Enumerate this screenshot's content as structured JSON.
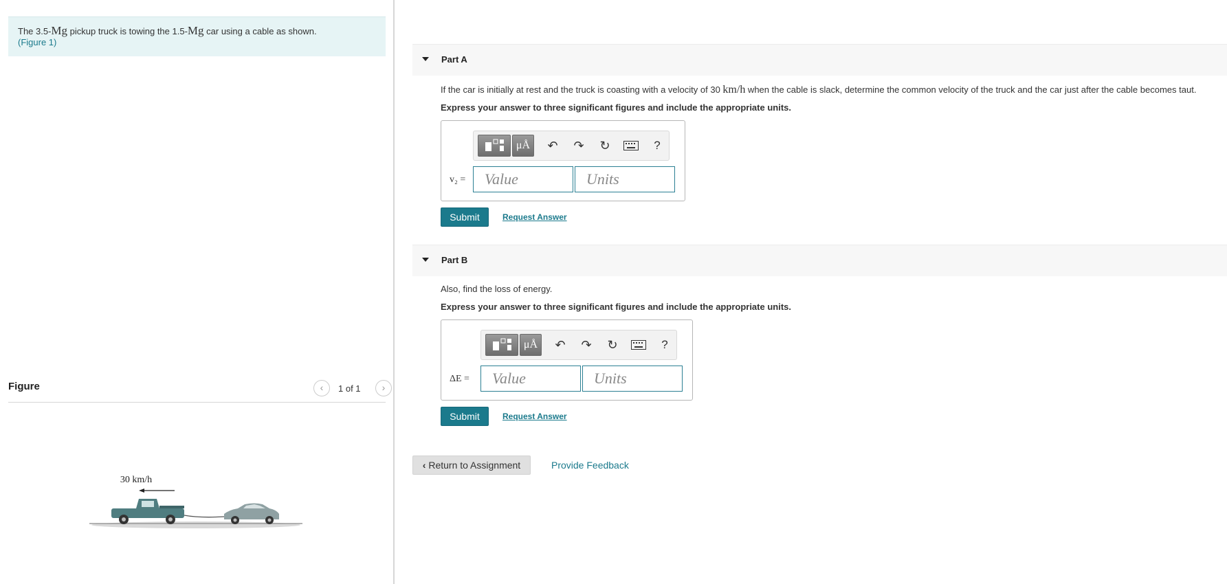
{
  "problem": {
    "text_1": "The 3.5-",
    "mass_truck_unit": "Mg",
    "text_2": " pickup truck is towing the 1.5-",
    "mass_car_unit": "Mg",
    "text_3": " car using a cable as shown.",
    "figure_link": "(Figure 1)"
  },
  "figure": {
    "title": "Figure",
    "pager_text": "1 of 1",
    "prev_icon": "chevron-left-icon",
    "next_icon": "chevron-right-icon",
    "velocity_label": "30 km/h",
    "colors": {
      "truck": "#4f7d80",
      "car": "#8fa1a3",
      "ground": "#c9c9c9"
    }
  },
  "partA": {
    "title": "Part A",
    "question_1": "If the car is initially at rest and the truck is coasting with a velocity of 30 ",
    "question_unit": "km/h",
    "question_2": " when the cable is slack, determine the common velocity of the truck and the car just after the cable becomes taut.",
    "instruction": "Express your answer to three significant figures and include the appropriate units.",
    "var_label": "v₂ =",
    "value_placeholder": "Value",
    "units_placeholder": "Units",
    "units_button": "μÅ",
    "submit": "Submit",
    "request": "Request Answer"
  },
  "partB": {
    "title": "Part B",
    "question": "Also, find the loss of energy.",
    "instruction": "Express your answer to three significant figures and include the appropriate units.",
    "var_label": "ΔE =",
    "value_placeholder": "Value",
    "units_placeholder": "Units",
    "units_button": "μÅ",
    "submit": "Submit",
    "request": "Request Answer"
  },
  "toolbar": {
    "undo": "↶",
    "redo": "↷",
    "reset": "↻",
    "help": "?"
  },
  "footer": {
    "return": "Return to Assignment",
    "feedback": "Provide Feedback"
  },
  "colors": {
    "accent": "#1b7a8c",
    "problem_bg": "#e6f4f5",
    "toolbar_btn": "#7d7d7d"
  }
}
